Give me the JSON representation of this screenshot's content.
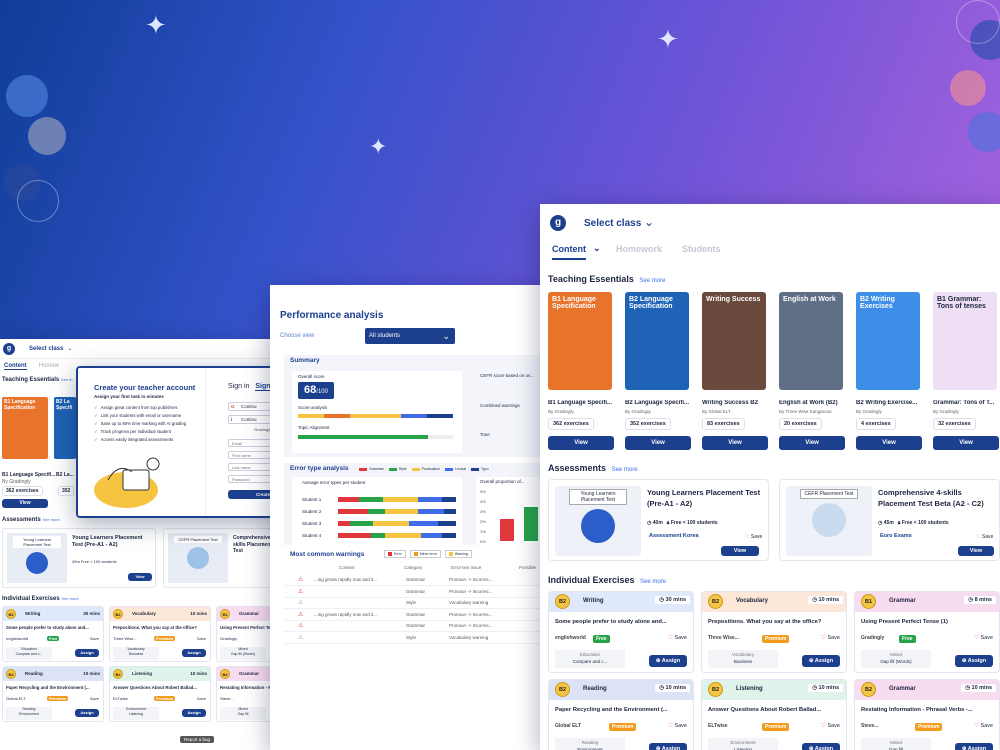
{
  "main_window": {
    "select_class": "Select class",
    "tabs": [
      "Content",
      "Homework",
      "Students"
    ],
    "teaching_essentials": {
      "heading": "Teaching Essentials",
      "see_more": "See more",
      "books": [
        {
          "cover_title": "B1 Language Specification",
          "title": "B1 Language Specifi...",
          "author": "By Gradingly",
          "count": "362 exercises",
          "view": "View",
          "cover_color": "#e8742c"
        },
        {
          "cover_title": "B2 Language Specification",
          "title": "B2 Language Specifi...",
          "author": "By Gradingly",
          "count": "352 exercises",
          "view": "View",
          "cover_color": "#1e63b5"
        },
        {
          "cover_title": "Writing Success",
          "title": "Writing Success B2",
          "author": "By Global ELT",
          "count": "83 exercises",
          "view": "View",
          "cover_color": "#6a4a3c"
        },
        {
          "cover_title": "English at Work",
          "title": "English at Work (B2)",
          "author": "By Three Wise Kangaroos",
          "count": "20 exercises",
          "view": "View",
          "cover_color": "#5e6f86"
        },
        {
          "cover_title": "B2 Writing Exercises",
          "title": "B2 Writing Exercise...",
          "author": "By Gradingly",
          "count": "4 exercises",
          "view": "View",
          "cover_color": "#3d8ee8"
        },
        {
          "cover_title": "B1 Grammar: Tons of tenses",
          "title": "Grammar: Tons of T...",
          "author": "By Gradingly",
          "count": "32 exercises",
          "view": "View",
          "cover_color": "#efdff5"
        }
      ]
    },
    "assessments": {
      "heading": "Assessments",
      "see_more": "See more",
      "items": [
        {
          "thumb_label": "Young Learners Placement Test",
          "title": "Young Learners Placement Test (Pre-A1 - A2)",
          "duration": "40m",
          "meta": "Free < 100 students",
          "publisher": "Assessment Korea",
          "save": "Save",
          "view": "View"
        },
        {
          "thumb_label": "CEFR Placement Test",
          "title": "Comprehensive 4-skills Placement Test Beta (A2 - C2)",
          "duration": "45m",
          "meta": "Free < 100 students",
          "publisher": "Euro Exams",
          "save": "Save",
          "view": "View"
        }
      ]
    },
    "individual": {
      "heading": "Individual Exercises",
      "see_more": "See more",
      "items": [
        {
          "level": "B2",
          "skill": "Writing",
          "time": "30 mins",
          "title": "Some people prefer to study alone and...",
          "publisher": "englishworld",
          "tag": "Free",
          "save": "Save",
          "focus": "Education",
          "focus_sub": "Compare and c...",
          "assign": "Assign",
          "color": "#dfe9fb"
        },
        {
          "level": "B2",
          "skill": "Vocabulary",
          "time": "10 mins",
          "title": "Prepositions. What you say at the office?",
          "publisher": "Three Wise...",
          "tag": "Premium",
          "save": "Save",
          "focus": "Vocabulary",
          "focus_sub": "Business",
          "assign": "Assign",
          "color": "#fde7d8"
        },
        {
          "level": "B1",
          "skill": "Grammar",
          "time": "8 mins",
          "title": "Using Present Perfect Tense (1)",
          "publisher": "Gradingly",
          "tag": "Free",
          "save": "Save",
          "focus": "Mixed",
          "focus_sub": "Gap fill (Words)",
          "assign": "Assign",
          "color": "#f8dcf0"
        },
        {
          "level": "B2",
          "skill": "Reading",
          "time": "10 mins",
          "title": "Paper Recycling and the Environment (...",
          "publisher": "Global ELT",
          "tag": "Premium",
          "save": "Save",
          "focus": "Reading",
          "focus_sub": "Environment",
          "assign": "Assign",
          "color": "#dde3f7"
        },
        {
          "level": "B2",
          "skill": "Listening",
          "time": "10 mins",
          "title": "Answer Questions About Robert Ballad...",
          "publisher": "ELTwise",
          "tag": "Premium",
          "save": "Save",
          "focus": "Environment",
          "focus_sub": "Listening",
          "assign": "Assign",
          "color": "#e0f3ea"
        },
        {
          "level": "B2",
          "skill": "Grammar",
          "time": "10 mins",
          "title": "Restating Information - Phrasal Verbs -...",
          "publisher": "Steve...",
          "tag": "Premium",
          "save": "Save",
          "focus": "Mixed",
          "focus_sub": "Gap fill",
          "assign": "Assign",
          "color": "#f8dcf0"
        }
      ]
    }
  },
  "perf_window": {
    "title": "Performance analysis",
    "choose_view": "Choose view",
    "select_value": "All students",
    "summary": {
      "heading": "Summary",
      "overall_score_label": "Overall score",
      "score": "68",
      "score_total": "/100",
      "score_analysis": "Score analysis",
      "topic_alignment": "Topic Alignment",
      "cefr_label": "CEFR score based on ov...",
      "combined_warnings": "Combined warnings",
      "tone": "Tone"
    },
    "error_type": {
      "heading": "Error type analysis",
      "legend": [
        "Grammar",
        "Style",
        "Punctuation",
        "Lexical",
        "Typo"
      ],
      "avg_label": "Average error types per student",
      "students": [
        "Student 1",
        "Student 2",
        "Student 3",
        "Student 4"
      ],
      "overall_prop": "Overall proportion of...",
      "pct_ticks": [
        "5%",
        "4%",
        "3%",
        "2%",
        "1%",
        "0%"
      ]
    },
    "warnings": {
      "heading": "Most common warnings",
      "legend": [
        "Error",
        "Minor error",
        "Warning"
      ],
      "columns": [
        "Context",
        "Category",
        "Error text issue",
        "Possible"
      ],
      "rows": [
        {
          "context": "...ing grows rapidly now and it...",
          "category": "Grammar",
          "issue": "Pronoun -> Incorrec..."
        },
        {
          "context": "",
          "category": "Grammar",
          "issue": "Pronoun -> Incorrec..."
        },
        {
          "context": "",
          "category": "Style",
          "issue": "Vocabulary warning"
        },
        {
          "context": "...ing grows rapidly now and it...",
          "category": "Grammar",
          "issue": "Pronoun -> Incorrec..."
        },
        {
          "context": "",
          "category": "Grammar",
          "issue": "Pronoun -> Incorrec..."
        },
        {
          "context": "",
          "category": "Style",
          "issue": "Vocabulary warning"
        }
      ]
    }
  },
  "left_window": {
    "select_class": "Select class",
    "tab_content": "Content",
    "tab_homework": "Homew",
    "teaching_essentials": "Teaching Essentials",
    "see_more": "See m",
    "book1": "B1 Language Specification",
    "book2": "B2 La Specifi",
    "book1_title": "B1 Language Specifi...",
    "book2_title": "B2 La...",
    "book_author": "By Gradingly",
    "count1": "362 exercises",
    "count2": "352",
    "view": "View",
    "assessments": "Assessments",
    "assess_see_more": "See more",
    "assess1_thumb": "Young Learners Placement Test",
    "assess1_title": "Young Learners Placement Test (Pre-A1 - A2)",
    "assess1_meta": "40m  Free < 100 students",
    "assess2_thumb": "CEFR Placement Test",
    "assess2_title": "Comprehensive 4-skills Placement Test",
    "save": "Save",
    "individual": "Individual Exercises",
    "ind_see_more": "See more",
    "report_bug": "Report a bug"
  },
  "modal": {
    "title": "Create your teacher account",
    "subtitle": "Assign your first task in minutes",
    "benefits": [
      "Assign great content from top publishers",
      "Link your students with email or username",
      "Save up to 80% time marking with AI grading",
      "Track progress per individual student",
      "Access easily integrated assessments"
    ],
    "sign_in": "Sign in",
    "sign_up": "Sign",
    "google": "Continu",
    "continue2": "Continu",
    "graphic_label": "Gradingly",
    "email": "Email",
    "first_name": "First name",
    "last_name": "Last name",
    "password": "Password",
    "create": "Create"
  },
  "colors": {
    "brand_navy": "#1c3f8e",
    "accent_blue": "#3d6ee8",
    "level_yellow": "#f5c542",
    "premium_orange": "#f29b1e",
    "free_green": "#27a34a"
  }
}
